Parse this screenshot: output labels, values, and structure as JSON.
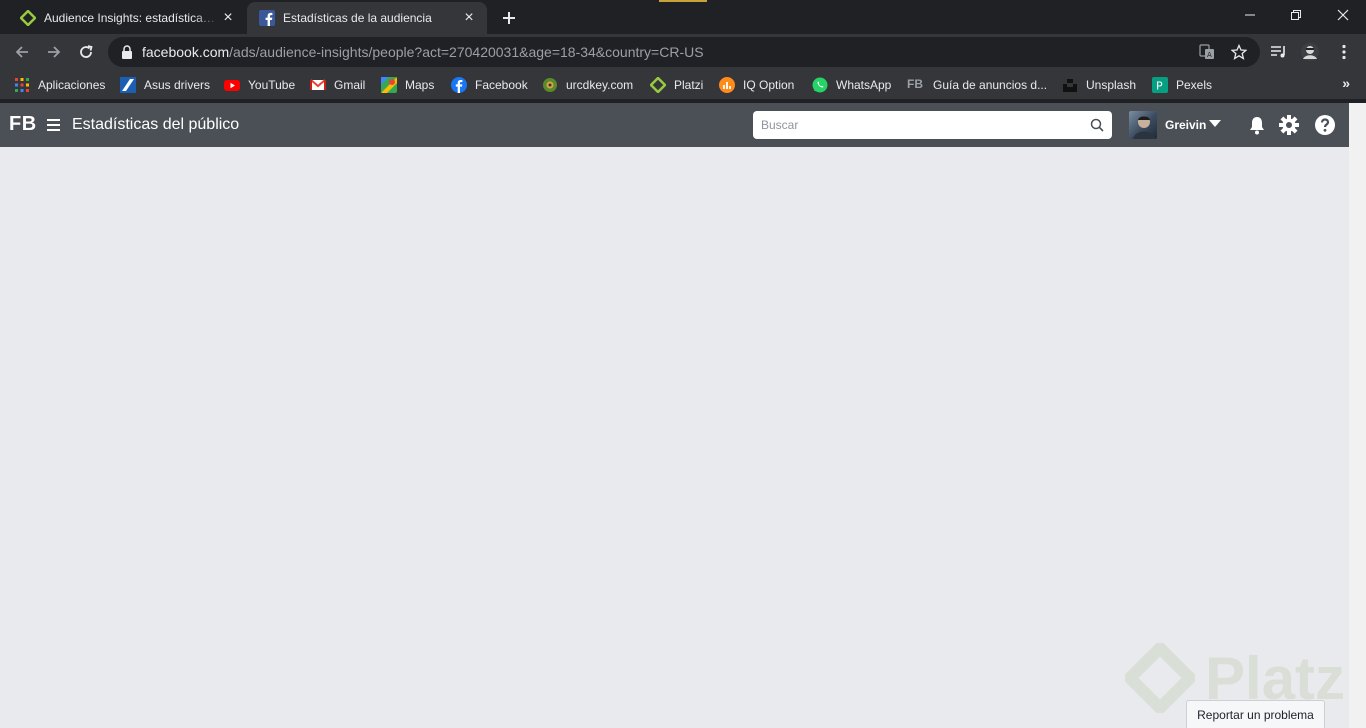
{
  "browser": {
    "tabs": [
      {
        "title": "Audience Insights: estadísticas de la audiencia",
        "favicon": "platzi-icon",
        "active": false
      },
      {
        "title": "Estadísticas de la audiencia",
        "favicon": "facebook-icon",
        "active": true
      }
    ],
    "url_domain": "facebook.com",
    "url_path": "/ads/audience-insights/people?act=270420031&age=18-34&country=CR-US",
    "bookmarks": [
      {
        "label": "Aplicaciones",
        "icon": "apps-grid-icon"
      },
      {
        "label": "Asus drivers",
        "icon": "asus-icon"
      },
      {
        "label": "YouTube",
        "icon": "youtube-icon"
      },
      {
        "label": "Gmail",
        "icon": "gmail-icon"
      },
      {
        "label": "Maps",
        "icon": "maps-icon"
      },
      {
        "label": "Facebook",
        "icon": "facebook-icon"
      },
      {
        "label": "urcdkey.com",
        "icon": "urcdkey-icon"
      },
      {
        "label": "Platzi",
        "icon": "platzi-icon"
      },
      {
        "label": "IQ Option",
        "icon": "iqoption-icon"
      },
      {
        "label": "WhatsApp",
        "icon": "whatsapp-icon"
      },
      {
        "label": "Guía de anuncios d...",
        "icon": "fb-text-icon"
      },
      {
        "label": "Unsplash",
        "icon": "unsplash-icon"
      },
      {
        "label": "Pexels",
        "icon": "pexels-icon"
      }
    ],
    "bookmarks_more": "»"
  },
  "fb": {
    "logo": "FB",
    "title": "Estadísticas del público",
    "search_placeholder": "Buscar",
    "user_name": "Greivin",
    "report_button": "Reportar un problema",
    "watermark": "Platzi"
  },
  "colors": {
    "tab_strip": "#202124",
    "toolbar": "#35363a",
    "fb_header": "#4b4f56",
    "page_bg": "#e9eaed"
  }
}
